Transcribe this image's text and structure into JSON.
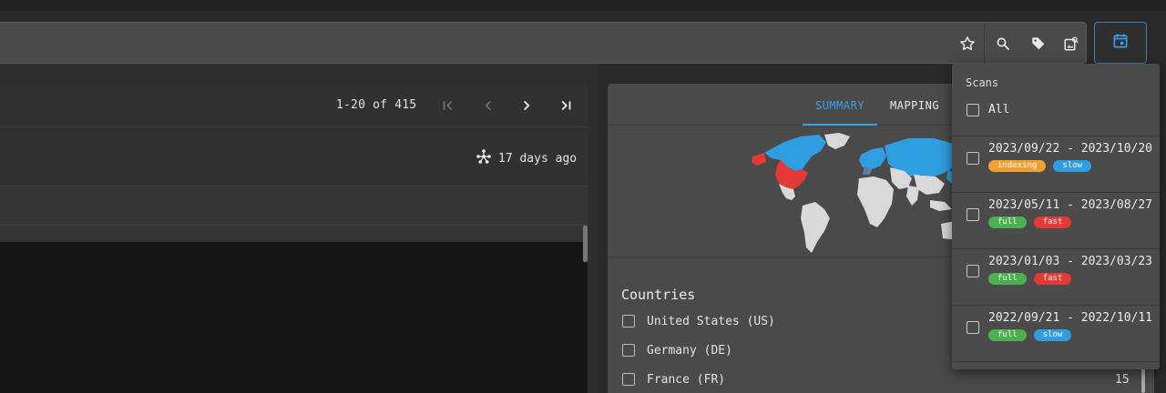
{
  "toolbar": {
    "icons": [
      "star-icon",
      "search-icon",
      "tag-icon",
      "image-search-icon"
    ],
    "calendar_icon": "calendar-icon"
  },
  "pager": {
    "range": "1-20 of 415",
    "icons": [
      "first-page-icon",
      "prev-page-icon",
      "next-page-icon",
      "last-page-icon"
    ]
  },
  "info": {
    "age": "17 days ago",
    "icon": "fork-icon"
  },
  "summary": {
    "tabs": [
      {
        "label": "SUMMARY",
        "active": true
      },
      {
        "label": "MAPPING",
        "active": false
      }
    ],
    "countries_title": "Countries",
    "countries": [
      {
        "label": "United States (US)",
        "count": ""
      },
      {
        "label": "Germany (DE)",
        "count": ""
      },
      {
        "label": "France (FR)",
        "count": "15"
      }
    ]
  },
  "scans": {
    "title": "Scans",
    "all_label": "All",
    "items": [
      {
        "range": "2023/09/22 - 2023/10/20",
        "tags": [
          {
            "label": "indexing",
            "color": "#f0a030"
          },
          {
            "label": "slow",
            "color": "#2f9ee0"
          }
        ]
      },
      {
        "range": "2023/05/11 - 2023/08/27",
        "tags": [
          {
            "label": "full",
            "color": "#4caf50"
          },
          {
            "label": "fast",
            "color": "#e53935"
          }
        ]
      },
      {
        "range": "2023/01/03 - 2023/03/23",
        "tags": [
          {
            "label": "full",
            "color": "#4caf50"
          },
          {
            "label": "fast",
            "color": "#e53935"
          }
        ]
      },
      {
        "range": "2022/09/21 - 2022/10/11",
        "tags": [
          {
            "label": "full",
            "color": "#4caf50"
          },
          {
            "label": "slow",
            "color": "#2f9ee0"
          }
        ]
      }
    ]
  },
  "colors": {
    "accent": "#3aa0e6",
    "map_highlight": "#e53935",
    "map_active": "#2f9ee0",
    "map_default": "#d9d9d9"
  }
}
